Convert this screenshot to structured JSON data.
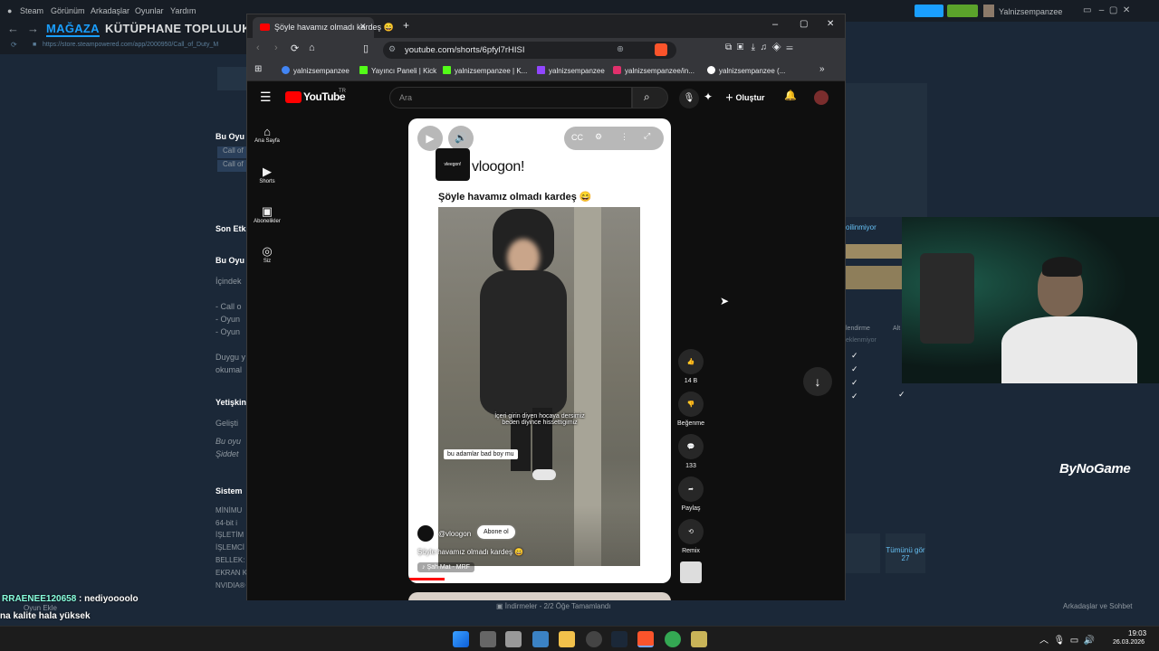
{
  "steam": {
    "menu": [
      "Steam",
      "Görünüm",
      "Arkadaşlar",
      "Oyunlar",
      "Yardım"
    ],
    "nav_tabs": [
      "MAĞAZA",
      "KÜTÜPHANE",
      "TOPLULUK"
    ],
    "url": "https://store.steampowered.com/app/2000950/Call_of_Duty_M",
    "username": "Yalnizsempanzee",
    "left_snippets": [
      "Bu Oyu",
      "Call of",
      "Call of",
      "Son Etk",
      "Bu Oyu",
      "İçindek",
      "- Call o",
      "- Oyun",
      "- Oyun",
      "Duygu y",
      "okumal",
      "Yetişkin",
      "Gelişti",
      "Bu oyu",
      "Şiddet",
      "Sistem",
      "MİNİMU",
      "64-bit i",
      "İŞLETİM",
      "İŞLEMCİ",
      "BELLEK:",
      "EKRAN K",
      "NVIDIA®"
    ],
    "right_snippets": {
      "heading": "oilinmiyor",
      "col1": "lendirme",
      "col2": "Alt",
      "sub": "eklenmiyor",
      "all_button": "Tümünü gör 27"
    },
    "downloads": "İndirmeler - 2/2 Öğe Tamamlandı",
    "friends": "Arkadaşlar ve Sohbet",
    "add_game": "Oyun Ekle"
  },
  "browser": {
    "tab_title": "Şöyle havamız olmadı kardeş 😄",
    "url": "youtube.com/shorts/6pfyl7rHISI",
    "bookmarks": [
      "yalnizsempanzee",
      "Yayıncı Paneli | Kick",
      "yalnizsempanzee | K...",
      "yalnizsempanzee",
      "yalnizsempanzee/in...",
      "yalnizsempanzee (..."
    ],
    "bookmark_colors": [
      "#4285f4",
      "#53fc18",
      "#53fc18",
      "#9146ff",
      "#e1306c",
      "#ffffff"
    ]
  },
  "youtube": {
    "logo": "YouTube",
    "country": "TR",
    "search_placeholder": "Ara",
    "create_label": "Oluştur",
    "sidebar": [
      "Ana Sayfa",
      "Shorts",
      "Abonelikler",
      "Siz"
    ],
    "short": {
      "brand": "vloogon!",
      "brand_badge": "vleegon!",
      "title": "Şöyle havamız olmadı kardeş 😄",
      "caption1": "İçeri girin diyen hocaya dersimiz beden diyince hissettigimiz",
      "caption2": "bu adamlar bad boy mu",
      "channel": "@vloogon",
      "subscribe": "Abone ol",
      "desc": "Şöyle havamız olmadı kardeş 😄",
      "music": "Şah Mat - MRF"
    },
    "actions": {
      "like_count": "14 B",
      "dislike": "Beğenme",
      "comments": "133",
      "share": "Paylaş",
      "remix": "Remix"
    }
  },
  "overlay": {
    "chat_user": "RRAENEE120658",
    "chat_msg": ": nediyoooolo",
    "chat2": "na kalite hala yüksek",
    "brand": "ByNoGame"
  },
  "taskbar": {
    "time": "19:03",
    "date": "26.03.2026"
  }
}
